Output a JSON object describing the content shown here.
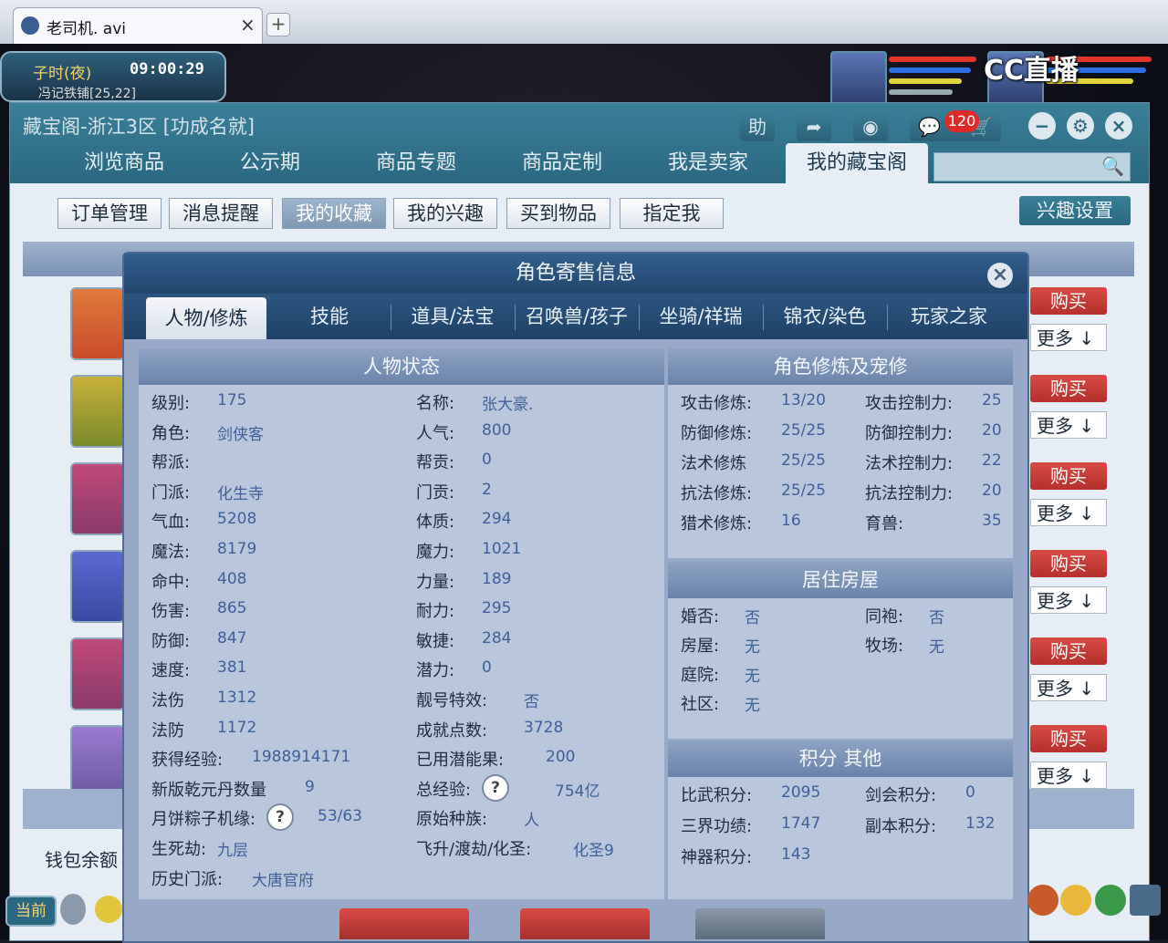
{
  "browser": {
    "tab_title": "老司机. avi",
    "new_tab": "+",
    "close": "×"
  },
  "game": {
    "time_period": "子时(夜)",
    "clock": "09:00:29",
    "location": "冯记铁铺[25,22]",
    "stream_logo": "CC直播"
  },
  "window": {
    "title": "藏宝阁-浙江3区 [功成名就]",
    "help_label": "助",
    "notif_count": "120",
    "nav_tabs": [
      "浏览商品",
      "公示期",
      "商品专题",
      "商品定制",
      "我是卖家",
      "我的藏宝阁"
    ],
    "sub_tabs": [
      "订单管理",
      "消息提醒",
      "我的收藏",
      "我的兴趣",
      "买到物品",
      "指定我"
    ],
    "interest_settings": "兴趣设置",
    "buy_label": "购买",
    "more_label": "更多 ↓",
    "wallet_label": "钱包余额"
  },
  "modal": {
    "title": "角色寄售信息",
    "close": "×",
    "tabs": [
      "人物/修炼",
      "技能",
      "道具/法宝",
      "召唤兽/孩子",
      "坐骑/祥瑞",
      "锦衣/染色",
      "玩家之家"
    ],
    "status": {
      "title": "人物状态",
      "rows": [
        [
          {
            "l": "级别:",
            "v": "175"
          },
          {
            "l": "名称:",
            "v": "张大豪."
          }
        ],
        [
          {
            "l": "角色:",
            "v": "剑侠客"
          },
          {
            "l": "人气:",
            "v": "800"
          }
        ],
        [
          {
            "l": "帮派:",
            "v": ""
          },
          {
            "l": "帮贡:",
            "v": "0"
          }
        ],
        [
          {
            "l": "门派:",
            "v": "化生寺"
          },
          {
            "l": "门贡:",
            "v": "2"
          }
        ],
        [
          {
            "l": "气血:",
            "v": "5208"
          },
          {
            "l": "体质:",
            "v": "294"
          }
        ],
        [
          {
            "l": "魔法:",
            "v": "8179"
          },
          {
            "l": "魔力:",
            "v": "1021"
          }
        ],
        [
          {
            "l": "命中:",
            "v": "408"
          },
          {
            "l": "力量:",
            "v": "189"
          }
        ],
        [
          {
            "l": "伤害:",
            "v": "865"
          },
          {
            "l": "耐力:",
            "v": "295"
          }
        ],
        [
          {
            "l": "防御:",
            "v": "847"
          },
          {
            "l": "敏捷:",
            "v": "284"
          }
        ],
        [
          {
            "l": "速度:",
            "v": "381"
          },
          {
            "l": "潜力:",
            "v": "0"
          }
        ],
        [
          {
            "l": "法伤",
            "v": "1312"
          },
          {
            "l": "靓号特效:",
            "v": "否"
          }
        ],
        [
          {
            "l": "法防",
            "v": "1172"
          },
          {
            "l": "成就点数:",
            "v": "3728"
          }
        ],
        [
          {
            "l": "获得经验:",
            "v": "1988914171"
          },
          {
            "l": "已用潜能果:",
            "v": "200"
          }
        ],
        [
          {
            "l": "新版乾元丹数量",
            "v": "9"
          },
          {
            "l": "总经验:",
            "v": "754亿"
          }
        ],
        [
          {
            "l": "月饼粽子机缘:",
            "v": "53/63"
          },
          {
            "l": "原始种族:",
            "v": "人"
          }
        ],
        [
          {
            "l": "生死劫:",
            "v": "九层"
          },
          {
            "l": "飞升/渡劫/化圣:",
            "v": "化圣9"
          }
        ],
        [
          {
            "l": "历史门派:",
            "v": "大唐官府"
          },
          {
            "l": "",
            "v": ""
          }
        ]
      ]
    },
    "cultivation": {
      "title": "角色修炼及宠修",
      "rows": [
        [
          {
            "l": "攻击修炼:",
            "v": "13/20"
          },
          {
            "l": "攻击控制力:",
            "v": "25"
          }
        ],
        [
          {
            "l": "防御修炼:",
            "v": "25/25"
          },
          {
            "l": "防御控制力:",
            "v": "20"
          }
        ],
        [
          {
            "l": "法术修炼",
            "v": "25/25"
          },
          {
            "l": "法术控制力:",
            "v": "22"
          }
        ],
        [
          {
            "l": "抗法修炼:",
            "v": "25/25"
          },
          {
            "l": "抗法控制力:",
            "v": "20"
          }
        ],
        [
          {
            "l": "猎术修炼:",
            "v": "16"
          },
          {
            "l": "育兽:",
            "v": "35"
          }
        ]
      ]
    },
    "housing": {
      "title": "居住房屋",
      "rows": [
        [
          {
            "l": "婚否:",
            "v": "否"
          },
          {
            "l": "同袍:",
            "v": "否"
          }
        ],
        [
          {
            "l": "房屋:",
            "v": "无"
          },
          {
            "l": "牧场:",
            "v": "无"
          }
        ],
        [
          {
            "l": "庭院:",
            "v": "无"
          },
          {
            "l": "",
            "v": ""
          }
        ],
        [
          {
            "l": "社区:",
            "v": "无"
          },
          {
            "l": "",
            "v": ""
          }
        ]
      ]
    },
    "points": {
      "title": "积分 其他",
      "rows": [
        [
          {
            "l": "比武积分:",
            "v": "2095"
          },
          {
            "l": "剑会积分:",
            "v": "0"
          }
        ],
        [
          {
            "l": "三界功绩:",
            "v": "1747"
          },
          {
            "l": "副本积分:",
            "v": "132"
          }
        ],
        [
          {
            "l": "神器积分:",
            "v": "143"
          },
          {
            "l": "",
            "v": ""
          }
        ]
      ]
    }
  },
  "bottom": {
    "current_label": "当前"
  },
  "colors": {
    "accent": "#2a6880",
    "buy": "#c23a36",
    "modal_bg": "#98a9c8"
  }
}
